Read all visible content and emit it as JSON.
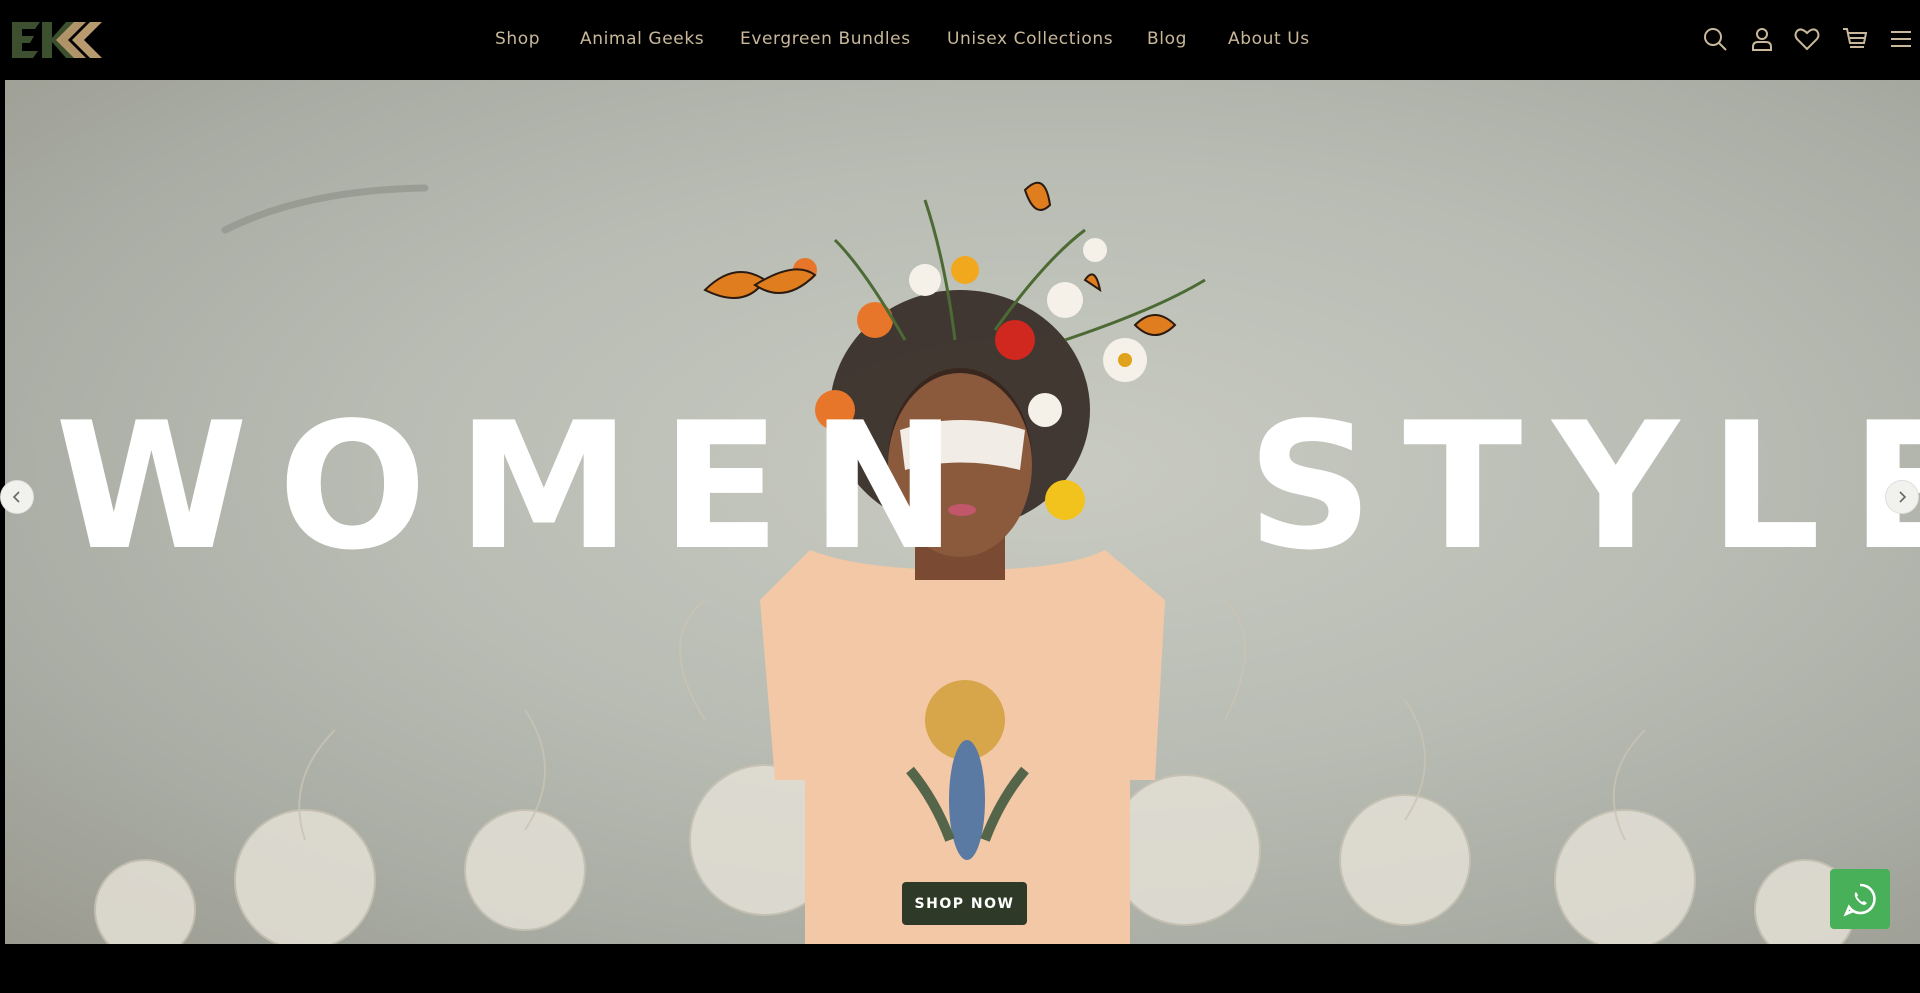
{
  "brand": {
    "logo_text": "EKK",
    "colors": {
      "green": "#3c4f2e",
      "tan": "#b89a6e",
      "nav_text": "#c9b99a",
      "button": "#2e3a27",
      "whatsapp": "#49b05a"
    }
  },
  "nav": {
    "items": [
      {
        "label": "Shop"
      },
      {
        "label": "Animal Geeks"
      },
      {
        "label": "Evergreen Bundles"
      },
      {
        "label": "Unisex Collections"
      },
      {
        "label": "Blog"
      },
      {
        "label": "About Us"
      }
    ]
  },
  "header_icons": [
    "search-icon",
    "account-icon",
    "wishlist-icon",
    "cart-icon",
    "menu-icon"
  ],
  "hero": {
    "word_left": "WOMEN",
    "word_right": "STYLE",
    "cta_label": "SHOP NOW",
    "prev_icon": "chevron-left-icon",
    "next_icon": "chevron-right-icon"
  },
  "whatsapp": {
    "icon": "whatsapp-icon"
  }
}
